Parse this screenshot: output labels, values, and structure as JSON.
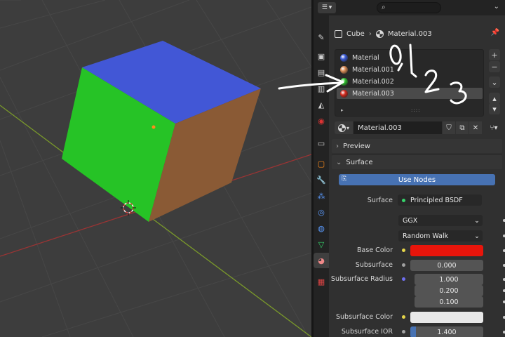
{
  "header": {
    "search_placeholder": ""
  },
  "breadcrumb": {
    "object": "Cube",
    "material": "Material.003"
  },
  "material_slots": [
    {
      "name": "Material",
      "color": "#3b5bd6"
    },
    {
      "name": "Material.001",
      "color": "#d88a55"
    },
    {
      "name": "Material.002",
      "color": "#2fbf2f"
    },
    {
      "name": "Material.003",
      "color": "#d42a1e",
      "active": true
    }
  ],
  "annotation": {
    "handwritten_numbers": "0,1,2,3"
  },
  "datablock": {
    "name": "Material.003"
  },
  "sections": {
    "preview": "Preview",
    "surface": "Surface"
  },
  "use_nodes_label": "Use Nodes",
  "properties": {
    "surface_label": "Surface",
    "surface_value": "Principled BSDF",
    "distribution": "GGX",
    "subsurface_method": "Random Walk",
    "base_color_label": "Base Color",
    "base_color": "#e8150b",
    "subsurface_label": "Subsurface",
    "subsurface_value": "0.000",
    "subsurface_radius_label": "Subsurface Radius",
    "subsurface_radius": [
      "1.000",
      "0.200",
      "0.100"
    ],
    "subsurface_color_label": "Subsurface Color",
    "subsurface_color": "#e8e8e8",
    "subsurface_ior_label": "Subsurface IOR",
    "subsurface_ior_value": "1.400",
    "subsurface_ior_fraction": 0.08
  },
  "cube_colors": {
    "top": "#4257d6",
    "left": "#26c326",
    "right": "#8a5a35"
  },
  "accent": "#4772b3"
}
